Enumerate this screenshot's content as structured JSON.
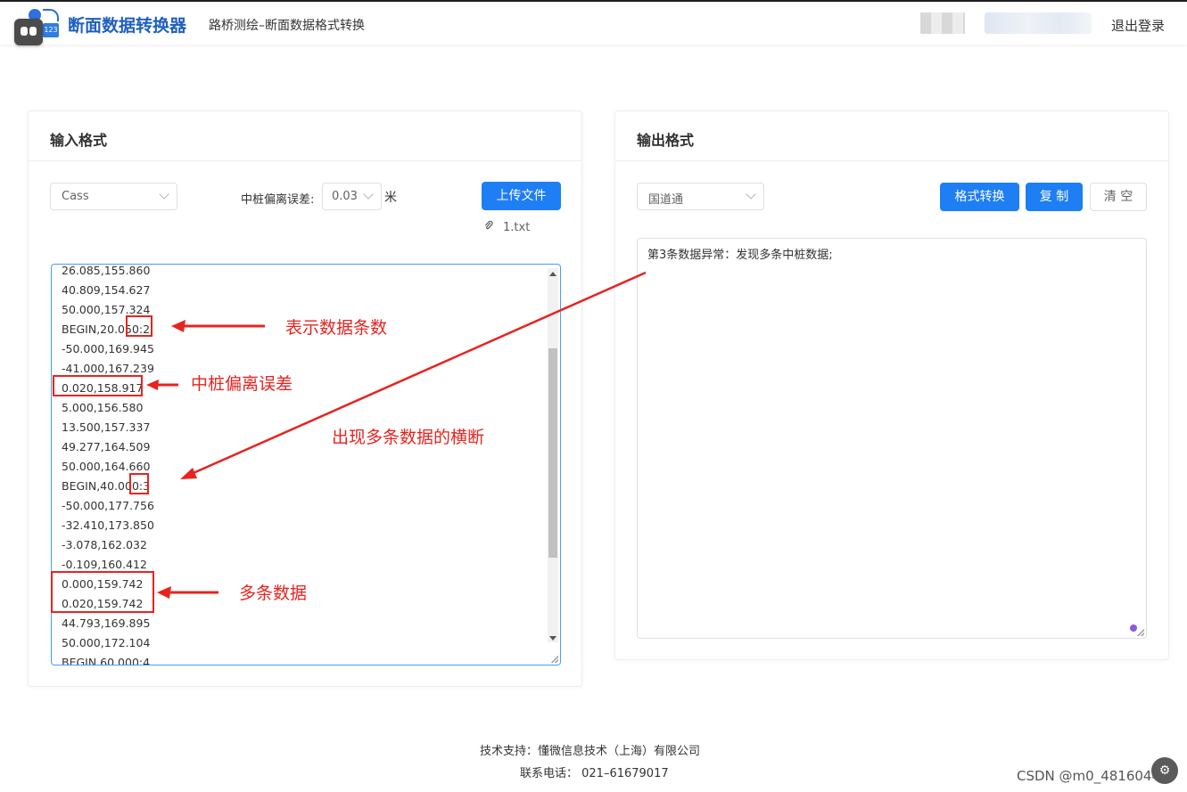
{
  "header": {
    "app_title": "断面数据转换器",
    "subtitle": "路桥测绘–断面数据格式转换",
    "logo_badge": "123",
    "logout": "退出登录"
  },
  "input_panel": {
    "title": "输入格式",
    "format_select": "Cass",
    "deviation_label": "中桩偏离误差:",
    "deviation_value": "0.03",
    "unit": "米",
    "upload_button": "上传文件",
    "file_name": "1.txt",
    "lines": [
      "26.085,155.860",
      "40.809,154.627",
      "50.000,157.324",
      "BEGIN,20.050:2",
      "-50.000,169.945",
      "-41.000,167.239",
      "0.020,158.917",
      "5.000,156.580",
      "13.500,157.337",
      "49.277,164.509",
      "50.000,164.660",
      "BEGIN,40.000:3",
      "-50.000,177.756",
      "-32.410,173.850",
      "-3.078,162.032",
      "-0.109,160.412",
      "0.000,159.742",
      "0.020,159.742",
      "44.793,169.895",
      "50.000,172.104",
      "BEGIN,60.000:4"
    ]
  },
  "output_panel": {
    "title": "输出格式",
    "format_select": "国道通",
    "convert_button": "格式转换",
    "copy_button": "复 制",
    "clear_button": "清 空",
    "output_text": "第3条数据异常：发现多条中桩数据;"
  },
  "annotations": {
    "count_label": "表示数据条数",
    "deviation_label": "中桩偏离误差",
    "multi_section_label": "出现多条数据的横断",
    "multi_data_label": "多条数据"
  },
  "footer": {
    "support": "技术支持：懂微信息技术（上海）有限公司",
    "phone": "联系电话： 021–61679017"
  },
  "watermark": "CSDN @m0_48160445",
  "colors": {
    "primary": "#1e7ef4",
    "title_blue": "#1f5fbf",
    "annotation_red": "#e8231f"
  }
}
